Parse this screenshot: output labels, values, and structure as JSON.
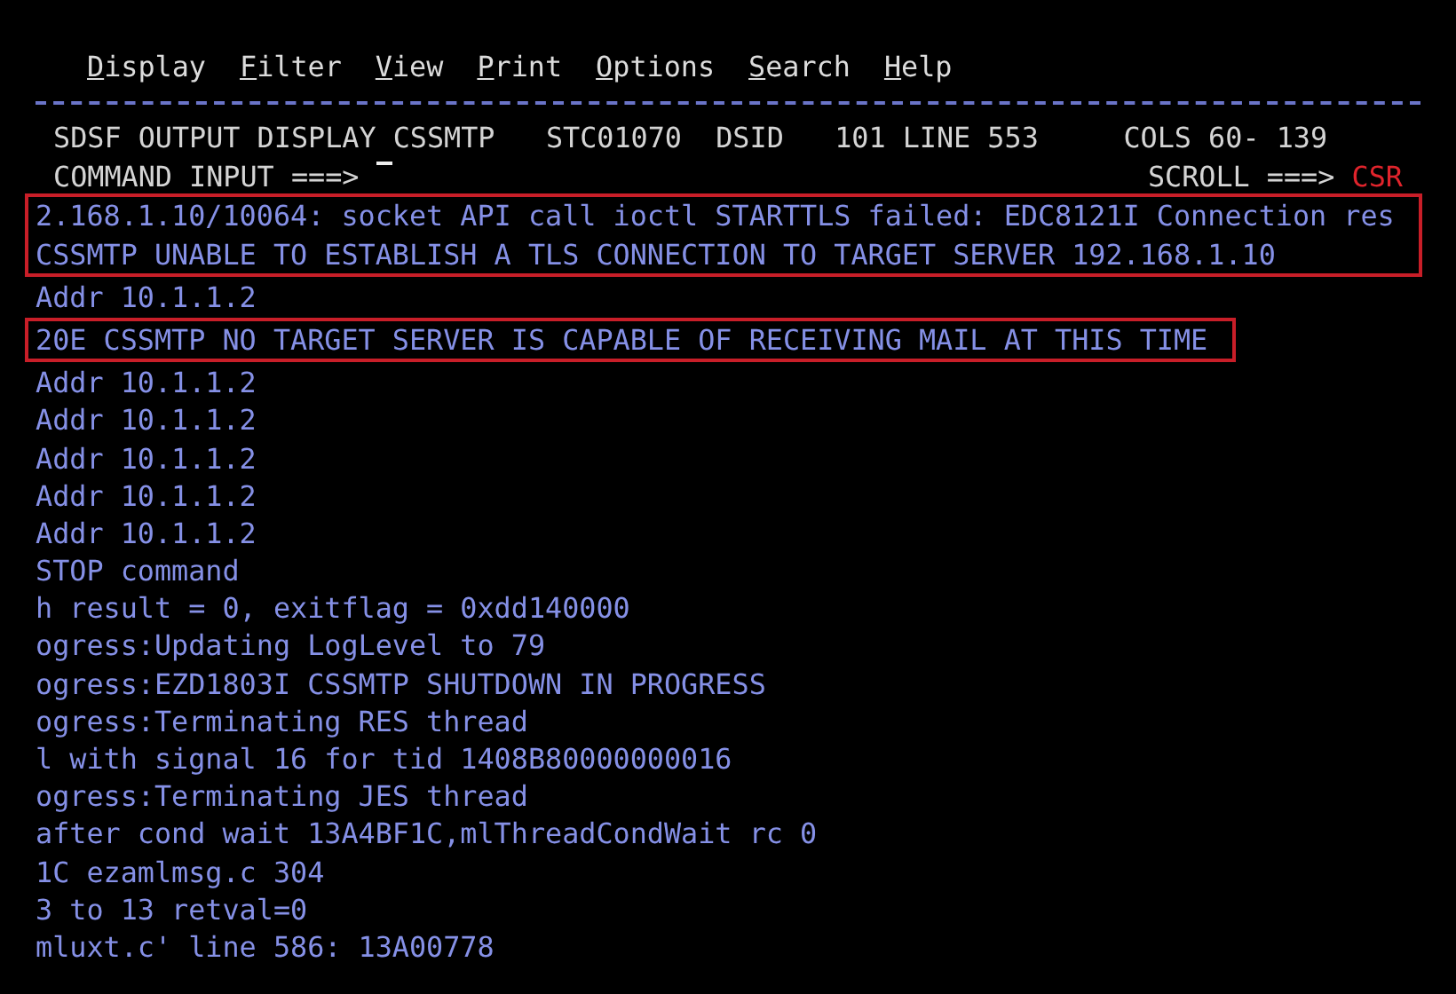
{
  "menu": [
    "Display",
    "Filter",
    "View",
    "Print",
    "Options",
    "Search",
    "Help"
  ],
  "header": {
    "title": "SDSF OUTPUT DISPLAY CSSMTP   STC01070  DSID   101 LINE 553     COLS 60- 139",
    "command_label": "COMMAND INPUT ===>",
    "scroll_label": "SCROLL ===>",
    "scroll_value": "CSR"
  },
  "log": [
    {
      "highlighted": true,
      "lines": [
        "2.168.1.10/10064: socket API call ioctl STARTTLS failed: EDC8121I Connection res",
        "CSSMTP UNABLE TO ESTABLISH A TLS CONNECTION TO TARGET SERVER 192.168.1.10"
      ]
    },
    {
      "highlighted": false,
      "lines": [
        "Addr 10.1.1.2"
      ]
    },
    {
      "highlighted": true,
      "lines": [
        "20E CSSMTP NO TARGET SERVER IS CAPABLE OF RECEIVING MAIL AT THIS TIME"
      ]
    },
    {
      "highlighted": false,
      "lines": [
        "Addr 10.1.1.2",
        "Addr 10.1.1.2",
        "Addr 10.1.1.2",
        "Addr 10.1.1.2",
        "Addr 10.1.1.2",
        "STOP command",
        "h result = 0, exitflag = 0xdd140000",
        "ogress:Updating LogLevel to 79",
        "ogress:EZD1803I CSSMTP SHUTDOWN IN PROGRESS",
        "ogress:Terminating RES thread",
        "l with signal 16 for tid 1408B80000000016",
        "ogress:Terminating JES thread",
        "after cond wait 13A4BF1C,mlThreadCondWait rc 0",
        "1C ezamlmsg.c 304",
        "3 to 13 retval=0",
        "mluxt.c' line 586: 13A00778"
      ]
    }
  ]
}
